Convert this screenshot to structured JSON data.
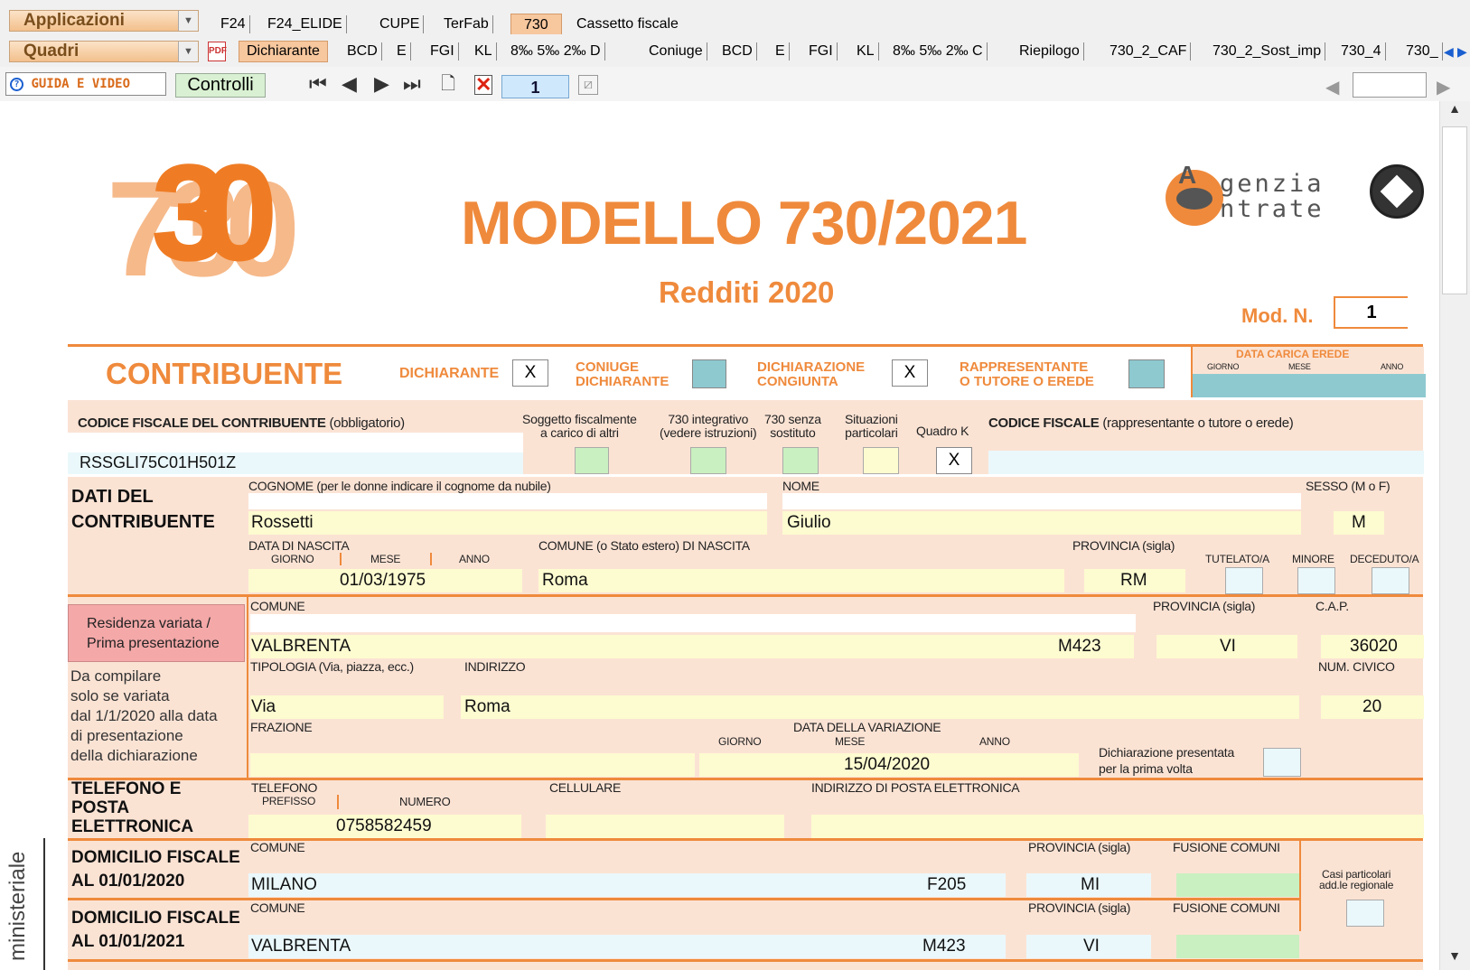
{
  "toolbar1": {
    "apps_label": "Applicazioni",
    "tabs": [
      "F24",
      "F24_ELIDE",
      "CUPE",
      "TerFab",
      "730",
      "Cassetto fiscale"
    ]
  },
  "toolbar2": {
    "quadri_label": "Quadri",
    "tabs": [
      "Dichiarante",
      "BCD",
      "E",
      "FGI",
      "KL",
      "8‰ 5‰ 2‰ D",
      "Coniuge",
      "BCD",
      "E",
      "FGI",
      "KL",
      "8‰ 5‰ 2‰ C",
      "Riepilogo",
      "730_2_CAF",
      "730_2_Sost_imp",
      "730_4",
      "730_"
    ]
  },
  "toolbar3": {
    "guide_label": "GUIDA E VIDEO",
    "controls_label": "Controlli",
    "page_number": "1"
  },
  "header": {
    "logo_number": "730",
    "title": "MODELLO 730/2021",
    "subtitle": "Redditi 2020",
    "mod_n_label": "Mod. N.",
    "mod_n_value": "1",
    "agency_line1": "genzia",
    "agency_line2": "ntrate",
    "agency_letter": "A"
  },
  "contribuente": {
    "title": "CONTRIBUENTE",
    "dichiarante_label": "DICHIARANTE",
    "dichiarante_value": "X",
    "coniuge_label": [
      "CONIUGE",
      "DICHIARANTE"
    ],
    "congiunta_label": [
      "DICHIARAZIONE",
      "CONGIUNTA"
    ],
    "congiunta_value": "X",
    "rappresentante_label": [
      "RAPPRESENTANTE",
      "O TUTORE O EREDE"
    ],
    "data_carica_label": "DATA CARICA EREDE",
    "giorno": "GIORNO",
    "mese": "MESE",
    "anno": "ANNO"
  },
  "codice": {
    "label_bold": "CODICE FISCALE DEL CONTRIBUENTE",
    "label_rest": "(obbligatorio)",
    "value": "RSSGLI75C01H501Z",
    "soggetto": [
      "Soggetto fiscalmente",
      "a carico di altri"
    ],
    "integrativo": [
      "730 integrativo",
      "(vedere istruzioni)"
    ],
    "senza": [
      "730 senza",
      "sostituto"
    ],
    "situazioni": [
      "Situazioni",
      "particolari"
    ],
    "quadro_k": "Quadro K",
    "quadro_k_value": "X",
    "rapp_bold": "CODICE FISCALE",
    "rapp_rest": "(rappresentante o tutore o erede)"
  },
  "dati": {
    "title": [
      "DATI DEL",
      "CONTRIBUENTE"
    ],
    "cognome_label": "COGNOME (per le donne indicare il cognome da nubile)",
    "cognome": "Rossetti",
    "nome_label": "NOME",
    "nome": "Giulio",
    "sesso_label": "SESSO (M o F)",
    "sesso": "M",
    "nascita_label": "DATA DI NASCITA",
    "giorno": "GIORNO",
    "mese": "MESE",
    "anno": "ANNO",
    "nascita": "01/03/1975",
    "comune_label": "COMUNE (o Stato estero) DI NASCITA",
    "comune": "Roma",
    "prov_label": "PROVINCIA (sigla)",
    "prov": "RM",
    "tutelato": "TUTELATO/A",
    "minore": "MINORE",
    "deceduto": "DECEDUTO/A"
  },
  "residenza": {
    "button": [
      "Residenza variata /",
      "Prima presentazione"
    ],
    "note": [
      "Da compilare",
      "solo se variata",
      "dal 1/1/2020 alla data",
      "di presentazione",
      "della dichiarazione"
    ],
    "comune_label": "COMUNE",
    "comune": "VALBRENTA",
    "codice": "M423",
    "prov_label": "PROVINCIA (sigla)",
    "prov": "VI",
    "cap_label": "C.A.P.",
    "cap": "36020",
    "tipologia_label": "TIPOLOGIA (Via, piazza, ecc.)",
    "tipologia": "Via",
    "indirizzo_label": "INDIRIZZO",
    "indirizzo": "Roma",
    "civico_label": "NUM. CIVICO",
    "civico": "20",
    "frazione_label": "FRAZIONE",
    "variazione_label": "DATA DELLA VARIAZIONE",
    "giorno": "GIORNO",
    "mese": "MESE",
    "anno": "ANNO",
    "variazione": "15/04/2020",
    "prima_volta": [
      "Dichiarazione presentata",
      "per la prima volta"
    ]
  },
  "telefono": {
    "title": [
      "TELEFONO E",
      "POSTA",
      "ELETTRONICA"
    ],
    "telefono_label": "TELEFONO",
    "prefisso": "PREFISSO",
    "numero_label": "NUMERO",
    "numero": "0758582459",
    "cellulare_label": "CELLULARE",
    "email_label": "INDIRIZZO DI POSTA ELETTRONICA"
  },
  "domicilio2020": {
    "title": [
      "DOMICILIO FISCALE",
      "AL 01/01/2020"
    ],
    "comune_label": "COMUNE",
    "comune": "MILANO",
    "codice": "F205",
    "prov_label": "PROVINCIA (sigla)",
    "prov": "MI",
    "fusione_label": "FUSIONE COMUNI",
    "casi": [
      "Casi particolari",
      "add.le regionale"
    ]
  },
  "domicilio2021": {
    "title": [
      "DOMICILIO FISCALE",
      "AL 01/01/2021"
    ],
    "comune_label": "COMUNE",
    "comune": "VALBRENTA",
    "codice": "M423",
    "prov_label": "PROVINCIA (sigla)",
    "prov": "VI",
    "fusione_label": "FUSIONE COMUNI"
  },
  "side_text": "ministeriale",
  "colors": {
    "accent_orange": "#ef8a3c",
    "section_bg": "#fbe3d4",
    "field_yellow": "#fdfbd0",
    "field_cyan": "#eaf8fb",
    "field_green": "#c9f0c0",
    "teal_box": "#8ec9d0",
    "pink_button": "#f4a8a8"
  }
}
